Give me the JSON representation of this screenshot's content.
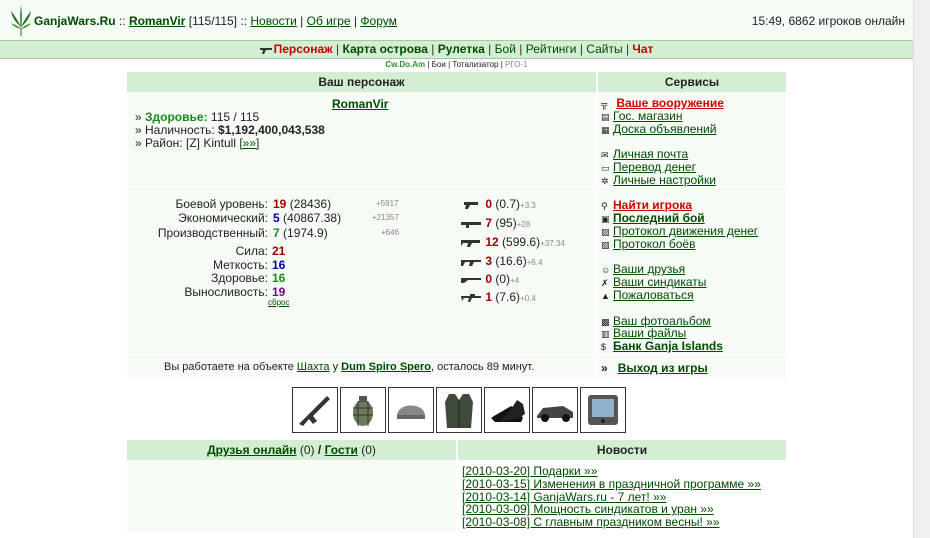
{
  "header": {
    "site": "GanjaWars.Ru",
    "sep1": "::",
    "user": "RomanVir",
    "hp": "[115/115]",
    "sep2": "::",
    "links": [
      "Новости",
      "Об игре",
      "Форум"
    ],
    "online": "15:49, 6862 игроков онлайн"
  },
  "menu": {
    "items": [
      "Персонаж",
      "Карта острова",
      "Рулетка",
      "Бой",
      "Рейтинги",
      "Сайты",
      "Чат"
    ]
  },
  "submenu": {
    "items": [
      "Cw.Do.Am",
      "Бои",
      "Тотализатор",
      "РГО-1"
    ]
  },
  "character": {
    "title": "Ваш персонаж",
    "name": "RomanVir",
    "health_label": "Здоровье:",
    "health_value": "115 / 115",
    "cash_label": "Наличность:",
    "cash_value": "$1,192,400,043,538",
    "district_label": "Район:",
    "district_value": "[Z] Kintull",
    "district_link": "[»»]",
    "levels": [
      {
        "label": "Боевой уровень:",
        "value": "19",
        "extra": "(28436)",
        "delta": "+5917"
      },
      {
        "label": "Экономический:",
        "value": "5",
        "extra": "(40867.38)",
        "delta": "+21357"
      },
      {
        "label": "Производственный:",
        "value": "7",
        "extra": "(1974.9)",
        "delta": "+646"
      }
    ],
    "attrs": [
      {
        "label": "Сила:",
        "value": "21"
      },
      {
        "label": "Меткость:",
        "value": "16"
      },
      {
        "label": "Здоровье:",
        "value": "16"
      },
      {
        "label": "Выносливость:",
        "value": "19"
      }
    ],
    "reset": "сброс",
    "weapons": [
      {
        "value": "0",
        "extra": "(0.7)",
        "delta": "+3.3"
      },
      {
        "value": "7",
        "extra": "(95)",
        "delta": "+28"
      },
      {
        "value": "12",
        "extra": "(599.6)",
        "delta": "+37.34"
      },
      {
        "value": "3",
        "extra": "(16.6)",
        "delta": "+6.4"
      },
      {
        "value": "0",
        "extra": "(0)",
        "delta": "+4"
      },
      {
        "value": "1",
        "extra": "(7.6)",
        "delta": "+0.4"
      }
    ],
    "work_prefix": "Вы работаете на объекте",
    "work_object": "Шахта",
    "work_mid": "у",
    "work_owner": "Dum Spiro Spero",
    "work_suffix": ", осталось 89 минут."
  },
  "services": {
    "title": "Сервисы",
    "groups": [
      [
        "Ваше вооружение",
        "Гос. магазин",
        "Доска объявлений"
      ],
      [
        "Личная почта",
        "Перевод денег",
        "Личные настройки"
      ],
      [
        "Найти игрока",
        "Последний бой",
        "Протокол движения денег",
        "Протокол боёв"
      ],
      [
        "Ваши друзья",
        "Ваши синдикаты",
        "Пожаловаться"
      ],
      [
        "Ваш фотоальбом",
        "Ваши файлы",
        "Банк Ganja Islands"
      ]
    ],
    "exit_bullet": "»",
    "exit": "Выход из игры"
  },
  "equipment": [
    "rifle",
    "grenade",
    "helmet",
    "vest",
    "boots",
    "car",
    "gps"
  ],
  "friends": {
    "label": "Друзья онлайн",
    "count": "(0)",
    "sep": "/",
    "guests": "Гости",
    "guests_count": "(0)"
  },
  "news": {
    "title": "Новости",
    "items": [
      "[2010-03-20] Подарки »»",
      "[2010-03-15] Изменения в праздничной программе »»",
      "[2010-03-14] GanjaWars.ru - 7 лет! »»",
      "[2010-03-09] Мощность синдикатов и уран »»",
      "[2010-03-08] С главным праздником весны! »»"
    ]
  },
  "colors": {
    "accent": "#004a00",
    "header_bg": "#d3eed3",
    "danger": "#d40000"
  }
}
